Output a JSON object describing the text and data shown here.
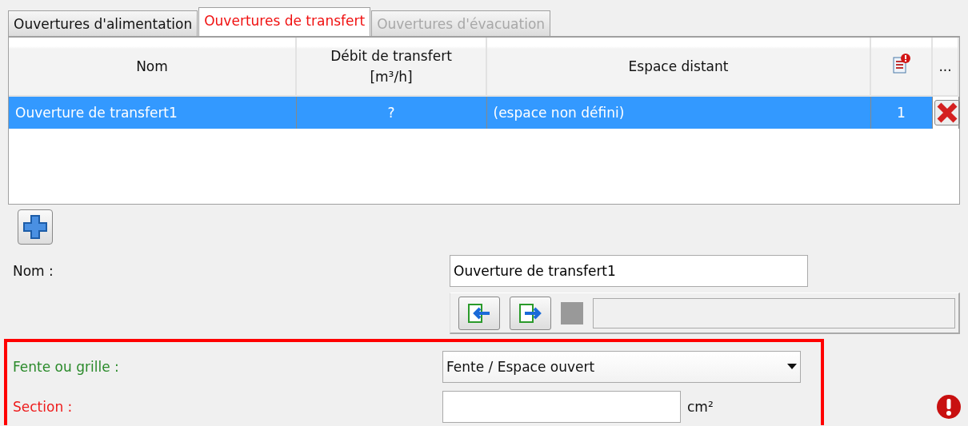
{
  "tabs": [
    {
      "label": "Ouvertures d'alimentation",
      "selected": false,
      "disabled": false
    },
    {
      "label": "Ouvertures de transfert",
      "selected": true,
      "disabled": false
    },
    {
      "label": "Ouvertures d'évacuation",
      "selected": false,
      "disabled": true
    }
  ],
  "table": {
    "columns": [
      {
        "kind": "text",
        "lines": [
          "Nom"
        ]
      },
      {
        "kind": "text",
        "lines": [
          "Débit de transfert",
          "[m³/h]"
        ]
      },
      {
        "kind": "text",
        "lines": [
          "Espace distant"
        ]
      },
      {
        "kind": "icon"
      },
      {
        "kind": "text",
        "lines": [
          "..."
        ]
      }
    ],
    "rows": [
      {
        "selected": true,
        "cells": [
          "Ouverture de transfert1",
          "?",
          "(espace non défini)",
          "1"
        ]
      }
    ]
  },
  "form": {
    "fields": [
      {
        "kind": "text",
        "label": "Nom :",
        "color": "#111111",
        "value": "Ouverture de transfert1"
      },
      {
        "kind": "toolbar"
      },
      {
        "kind": "combo",
        "label": "Fente ou grille :",
        "color": "#2a8a2a",
        "value": "Fente / Espace ouvert"
      },
      {
        "kind": "unit",
        "label": "Section :",
        "color": "#ee1b1b",
        "error": true,
        "unit": "cm²"
      }
    ]
  }
}
